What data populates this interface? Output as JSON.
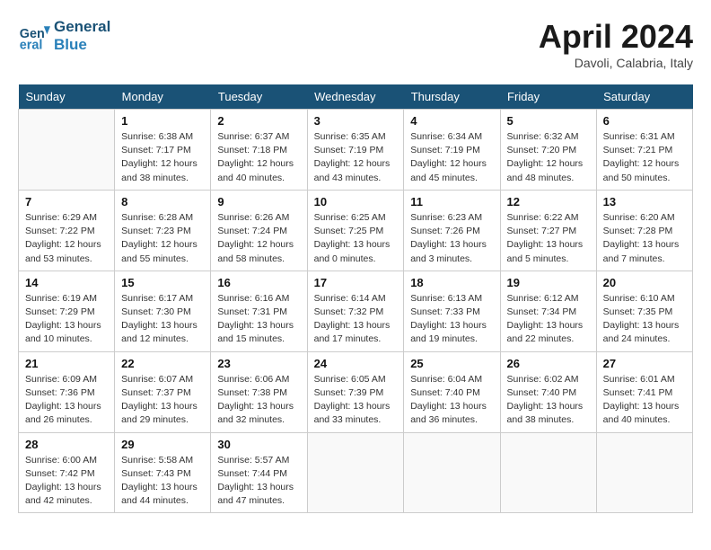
{
  "header": {
    "logo_line1": "General",
    "logo_line2": "Blue",
    "month": "April 2024",
    "location": "Davoli, Calabria, Italy"
  },
  "weekdays": [
    "Sunday",
    "Monday",
    "Tuesday",
    "Wednesday",
    "Thursday",
    "Friday",
    "Saturday"
  ],
  "weeks": [
    [
      {
        "day": "",
        "sunrise": "",
        "sunset": "",
        "daylight": ""
      },
      {
        "day": "1",
        "sunrise": "6:38 AM",
        "sunset": "7:17 PM",
        "daylight": "12 hours and 38 minutes."
      },
      {
        "day": "2",
        "sunrise": "6:37 AM",
        "sunset": "7:18 PM",
        "daylight": "12 hours and 40 minutes."
      },
      {
        "day": "3",
        "sunrise": "6:35 AM",
        "sunset": "7:19 PM",
        "daylight": "12 hours and 43 minutes."
      },
      {
        "day": "4",
        "sunrise": "6:34 AM",
        "sunset": "7:19 PM",
        "daylight": "12 hours and 45 minutes."
      },
      {
        "day": "5",
        "sunrise": "6:32 AM",
        "sunset": "7:20 PM",
        "daylight": "12 hours and 48 minutes."
      },
      {
        "day": "6",
        "sunrise": "6:31 AM",
        "sunset": "7:21 PM",
        "daylight": "12 hours and 50 minutes."
      }
    ],
    [
      {
        "day": "7",
        "sunrise": "6:29 AM",
        "sunset": "7:22 PM",
        "daylight": "12 hours and 53 minutes."
      },
      {
        "day": "8",
        "sunrise": "6:28 AM",
        "sunset": "7:23 PM",
        "daylight": "12 hours and 55 minutes."
      },
      {
        "day": "9",
        "sunrise": "6:26 AM",
        "sunset": "7:24 PM",
        "daylight": "12 hours and 58 minutes."
      },
      {
        "day": "10",
        "sunrise": "6:25 AM",
        "sunset": "7:25 PM",
        "daylight": "13 hours and 0 minutes."
      },
      {
        "day": "11",
        "sunrise": "6:23 AM",
        "sunset": "7:26 PM",
        "daylight": "13 hours and 3 minutes."
      },
      {
        "day": "12",
        "sunrise": "6:22 AM",
        "sunset": "7:27 PM",
        "daylight": "13 hours and 5 minutes."
      },
      {
        "day": "13",
        "sunrise": "6:20 AM",
        "sunset": "7:28 PM",
        "daylight": "13 hours and 7 minutes."
      }
    ],
    [
      {
        "day": "14",
        "sunrise": "6:19 AM",
        "sunset": "7:29 PM",
        "daylight": "13 hours and 10 minutes."
      },
      {
        "day": "15",
        "sunrise": "6:17 AM",
        "sunset": "7:30 PM",
        "daylight": "13 hours and 12 minutes."
      },
      {
        "day": "16",
        "sunrise": "6:16 AM",
        "sunset": "7:31 PM",
        "daylight": "13 hours and 15 minutes."
      },
      {
        "day": "17",
        "sunrise": "6:14 AM",
        "sunset": "7:32 PM",
        "daylight": "13 hours and 17 minutes."
      },
      {
        "day": "18",
        "sunrise": "6:13 AM",
        "sunset": "7:33 PM",
        "daylight": "13 hours and 19 minutes."
      },
      {
        "day": "19",
        "sunrise": "6:12 AM",
        "sunset": "7:34 PM",
        "daylight": "13 hours and 22 minutes."
      },
      {
        "day": "20",
        "sunrise": "6:10 AM",
        "sunset": "7:35 PM",
        "daylight": "13 hours and 24 minutes."
      }
    ],
    [
      {
        "day": "21",
        "sunrise": "6:09 AM",
        "sunset": "7:36 PM",
        "daylight": "13 hours and 26 minutes."
      },
      {
        "day": "22",
        "sunrise": "6:07 AM",
        "sunset": "7:37 PM",
        "daylight": "13 hours and 29 minutes."
      },
      {
        "day": "23",
        "sunrise": "6:06 AM",
        "sunset": "7:38 PM",
        "daylight": "13 hours and 32 minutes."
      },
      {
        "day": "24",
        "sunrise": "6:05 AM",
        "sunset": "7:39 PM",
        "daylight": "13 hours and 33 minutes."
      },
      {
        "day": "25",
        "sunrise": "6:04 AM",
        "sunset": "7:40 PM",
        "daylight": "13 hours and 36 minutes."
      },
      {
        "day": "26",
        "sunrise": "6:02 AM",
        "sunset": "7:40 PM",
        "daylight": "13 hours and 38 minutes."
      },
      {
        "day": "27",
        "sunrise": "6:01 AM",
        "sunset": "7:41 PM",
        "daylight": "13 hours and 40 minutes."
      }
    ],
    [
      {
        "day": "28",
        "sunrise": "6:00 AM",
        "sunset": "7:42 PM",
        "daylight": "13 hours and 42 minutes."
      },
      {
        "day": "29",
        "sunrise": "5:58 AM",
        "sunset": "7:43 PM",
        "daylight": "13 hours and 44 minutes."
      },
      {
        "day": "30",
        "sunrise": "5:57 AM",
        "sunset": "7:44 PM",
        "daylight": "13 hours and 47 minutes."
      },
      {
        "day": "",
        "sunrise": "",
        "sunset": "",
        "daylight": ""
      },
      {
        "day": "",
        "sunrise": "",
        "sunset": "",
        "daylight": ""
      },
      {
        "day": "",
        "sunrise": "",
        "sunset": "",
        "daylight": ""
      },
      {
        "day": "",
        "sunrise": "",
        "sunset": "",
        "daylight": ""
      }
    ]
  ],
  "labels": {
    "sunrise_prefix": "Sunrise: ",
    "sunset_prefix": "Sunset: ",
    "daylight_prefix": "Daylight: "
  }
}
